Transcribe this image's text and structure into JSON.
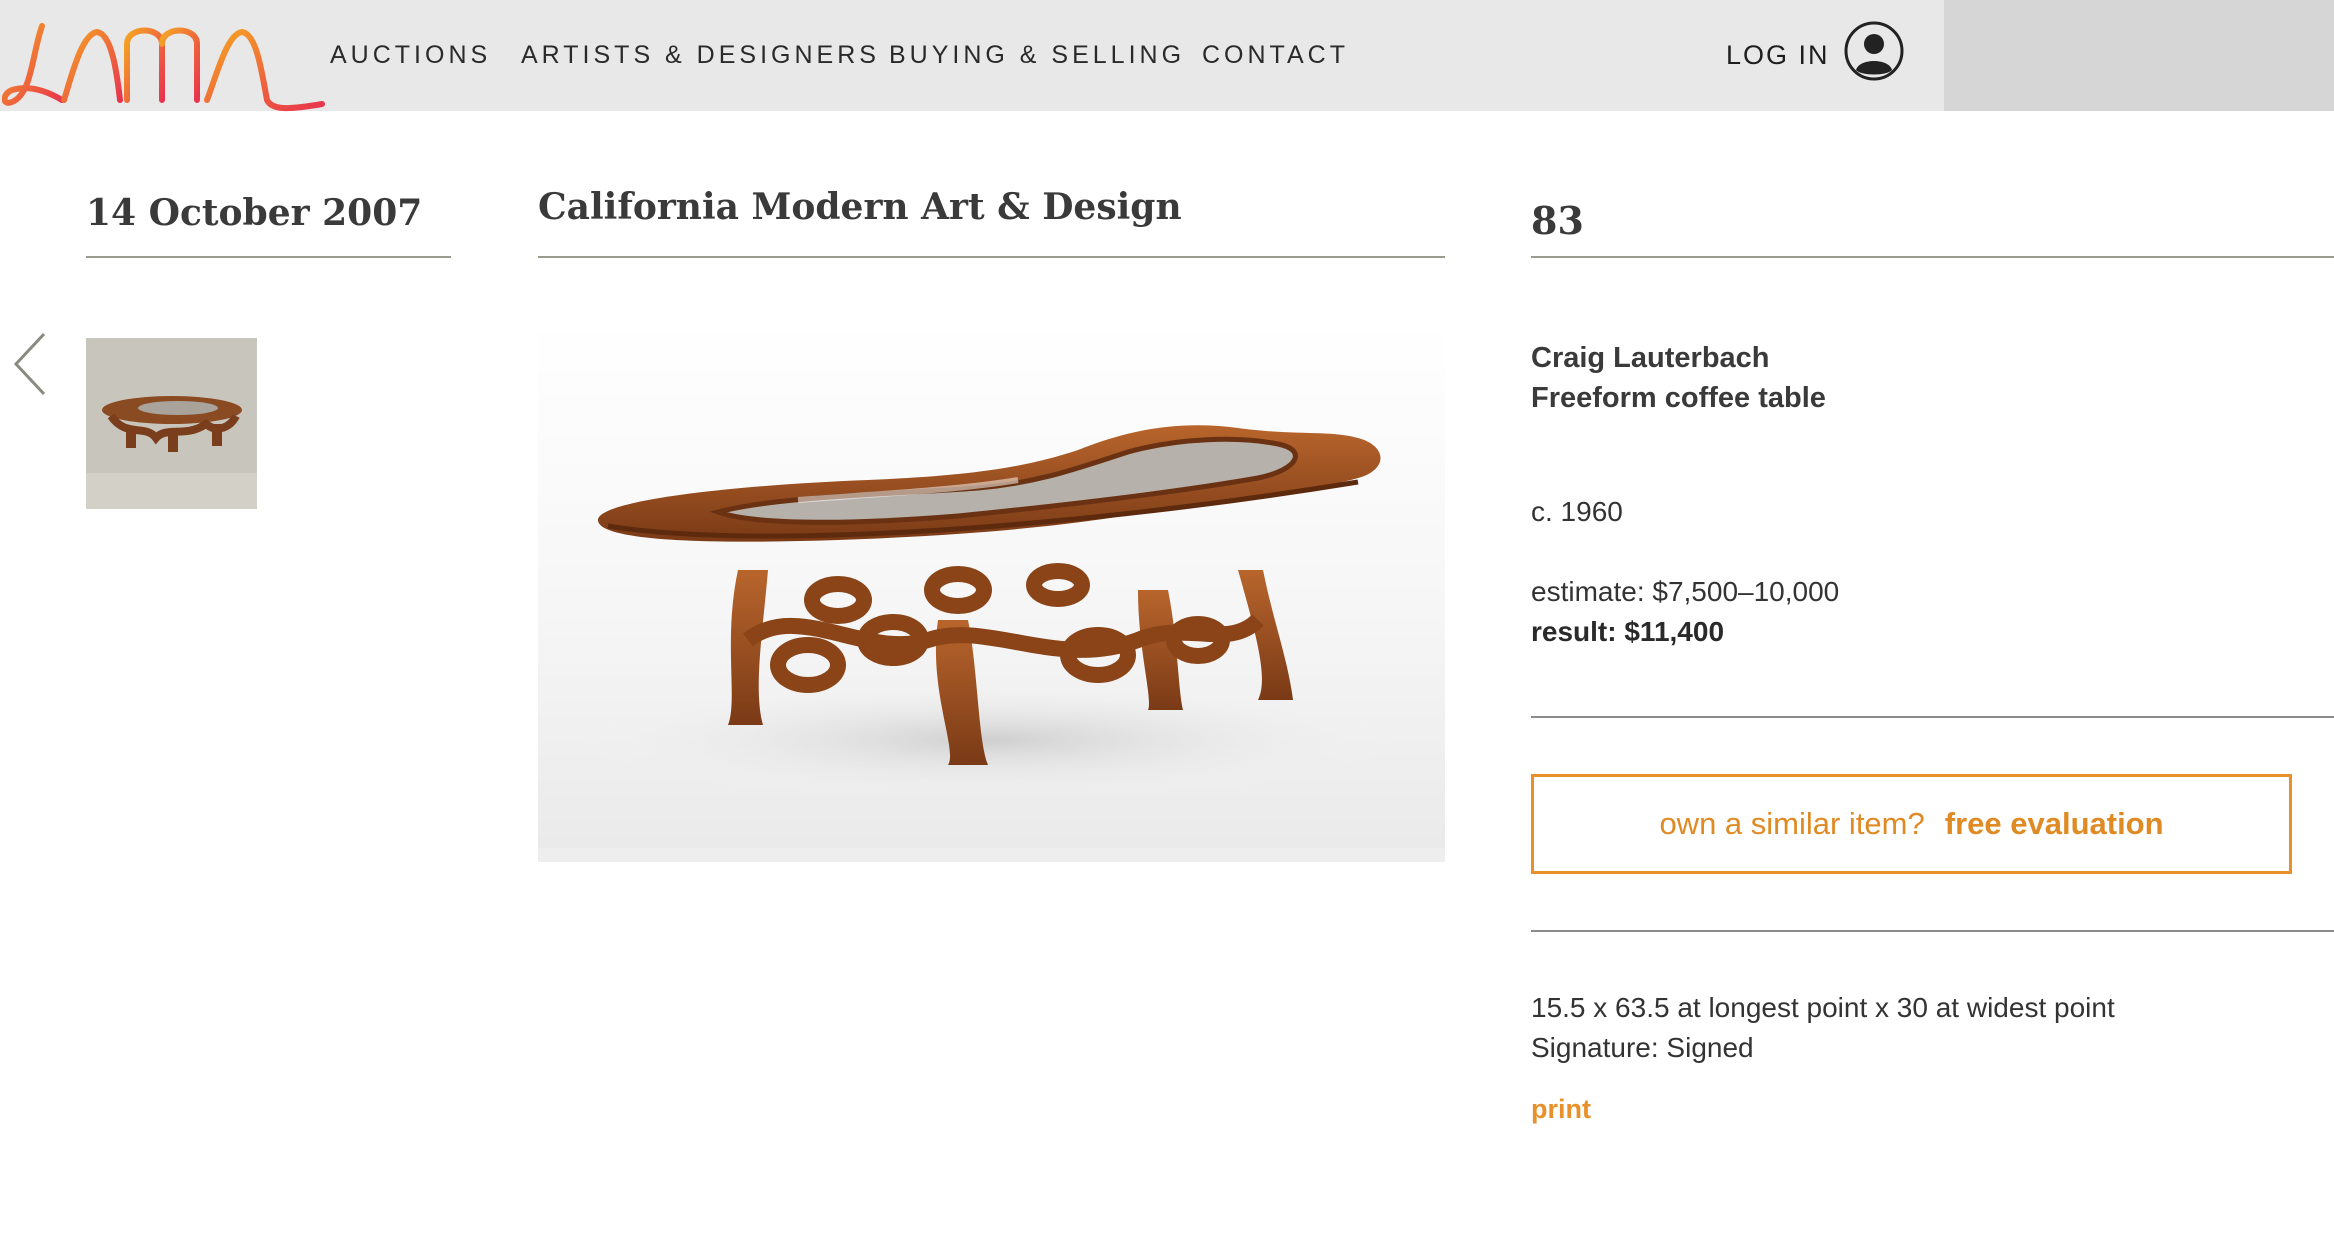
{
  "header": {
    "logo": "LAMA",
    "nav": [
      "AUCTIONS",
      "ARTISTS & DESIGNERS",
      "BUYING & SELLING",
      "CONTACT"
    ],
    "login_label": "LOG IN",
    "user_icon": "user-circle-icon"
  },
  "sale": {
    "date": "14 October 2007",
    "title": "California Modern Art & Design"
  },
  "lot": {
    "number": "83",
    "artist": "Craig Lauterbach",
    "title": "Freeform coffee table",
    "date_made": "c. 1960",
    "estimate": "estimate: $7,500–10,000",
    "result": "result: $11,400",
    "evaluation_prompt": "own a similar item?",
    "evaluation_link": "free evaluation",
    "dimensions": "15.5 x 63.5 at longest point x 30 at widest point",
    "signature": "Signature: Signed",
    "print_label": "print"
  },
  "icons": {
    "prev": "chevron-left-icon",
    "user": "user-circle-icon"
  },
  "colors": {
    "accent": "#e8912a",
    "header_bg": "#e8e8e8",
    "logo_gradient": [
      "#f5a623",
      "#e8344e"
    ]
  }
}
